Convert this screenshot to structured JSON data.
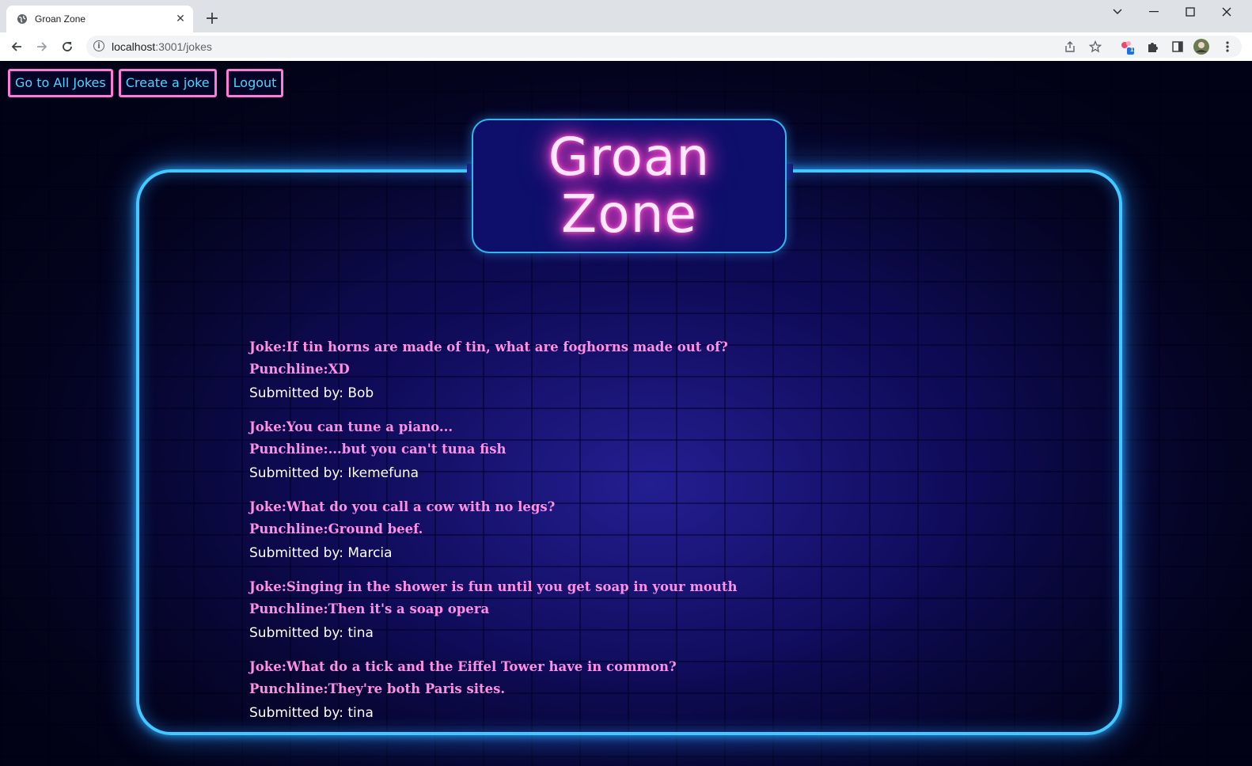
{
  "browser": {
    "tab_title": "Groan Zone",
    "tab_close": "✕",
    "new_tab": "+",
    "url_host": "localhost",
    "url_path": ":3001/jokes",
    "icons": {
      "tab_favicon": "globe-icon",
      "back": "back-arrow-icon",
      "forward": "forward-arrow-icon",
      "reload": "reload-icon",
      "site_info": "info-icon",
      "share": "share-icon",
      "bookmark": "star-icon",
      "extension_badge": "extension-badge-icon",
      "extensions": "puzzle-icon",
      "side_panel": "side-panel-icon",
      "profile": "avatar",
      "menu": "kebab-menu-icon"
    },
    "extension_badge_count": "1"
  },
  "nav": {
    "all_jokes": "Go to All Jokes",
    "create": "Create a joke",
    "logout": "Logout"
  },
  "logo": {
    "line1": "Groan",
    "line2": "Zone"
  },
  "jokes": [
    {
      "question": "Joke:If tin horns are made of tin, what are foghorns made out of?",
      "punchline": "Punchline:XD",
      "submitted": "Submitted by: Bob"
    },
    {
      "question": "Joke:You can tune a piano...",
      "punchline": "Punchline:...but you can't tuna fish",
      "submitted": "Submitted by: Ikemefuna"
    },
    {
      "question": "Joke:What do you call a cow with no legs?",
      "punchline": "Punchline:Ground beef.",
      "submitted": "Submitted by: Marcia"
    },
    {
      "question": "Joke:Singing in the shower is fun until you get soap in your mouth",
      "punchline": "Punchline:Then it's a soap opera",
      "submitted": "Submitted by: tina"
    },
    {
      "question": "Joke:What do a tick and the Eiffel Tower have in common?",
      "punchline": "Punchline:They're both Paris sites.",
      "submitted": "Submitted by: tina"
    }
  ],
  "colors": {
    "nav_border": "#ff7ad9",
    "nav_text": "#4fd4ff",
    "frame_glow": "#43c8ff",
    "joke_text": "#ff8fe3",
    "submitted_text": "#ffffff",
    "logo_glow": "#ff3fc7"
  }
}
